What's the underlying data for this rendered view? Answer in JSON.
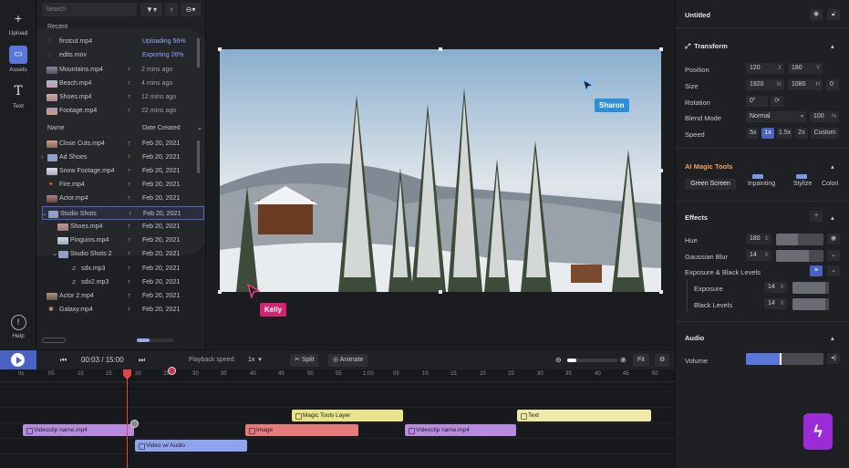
{
  "rail": {
    "upload": "Upload",
    "assets": "Assets",
    "text": "Text",
    "help": "Help"
  },
  "assets": {
    "search_placeholder": "Search",
    "recent_label": "Recent",
    "recent": [
      {
        "name": "firstcut.mp4",
        "status": "Uploading 56%"
      },
      {
        "name": "edits.mov",
        "status": "Exporting 26%"
      },
      {
        "name": "Mountains.mp4",
        "time": "2 mins ago"
      },
      {
        "name": "Beach.mp4",
        "time": "4 mins ago"
      },
      {
        "name": "Shoes.mp4",
        "time": "12 mins ago"
      },
      {
        "name": "Footage.mp4",
        "time": "22 mins ago"
      }
    ],
    "col_name": "Name",
    "col_date": "Date Created",
    "files": [
      {
        "name": "Close Cuts.mp4",
        "date": "Feb 20, 2021"
      },
      {
        "name": "Ad Shoes",
        "date": "Feb 20, 2021"
      },
      {
        "name": "Snow Footage.mp4",
        "date": "Feb 20, 2021"
      },
      {
        "name": "Fire.mp4",
        "date": "Feb 20, 2021"
      },
      {
        "name": "Actor.mp4",
        "date": "Feb 20, 2021"
      },
      {
        "name": "Studio Shots",
        "date": "Feb 20, 2021"
      },
      {
        "name": "Shoes.mp4",
        "date": "Feb 20, 2021"
      },
      {
        "name": "Pinguins.mp4",
        "date": "Feb 20, 2021"
      },
      {
        "name": "Studio Shots 2",
        "date": "Feb 20, 2021"
      },
      {
        "name": "sdx.mp3",
        "date": "Feb 20, 2021"
      },
      {
        "name": "sdx2.mp3",
        "date": "Feb 20, 2021"
      },
      {
        "name": "Actor 2.mp4",
        "date": "Feb 20, 2021"
      },
      {
        "name": "Galaxy.mp4",
        "date": "Feb 20, 2021"
      }
    ]
  },
  "stage": {
    "cursor_sharon": "Sharon",
    "cursor_kelly": "Kelly"
  },
  "transport": {
    "time": "00:03 / 15:00",
    "speed_label": "Playback speed:",
    "speed_value": "1x",
    "split": "Split",
    "animate": "Animate",
    "fit": "Fit"
  },
  "timeline": {
    "ticks": [
      "0s",
      "05",
      "10",
      "15",
      "20",
      "25",
      "30",
      "35",
      "40",
      "45",
      "50",
      "55",
      "1:00",
      "05",
      "10",
      "15",
      "20",
      "25",
      "30",
      "35",
      "40",
      "45",
      "50"
    ],
    "clips": {
      "magic": "Magic Tools Layer",
      "text": "Text",
      "video1": "Videoclip name.mp4",
      "image": "Image",
      "video2": "Videoclip name.mp4",
      "audio": "Video w/ Audio"
    }
  },
  "panel": {
    "title": "Untitled",
    "transform": {
      "heading": "Transform",
      "position": "Position",
      "pos_x": "120",
      "pos_y": "180",
      "size": "Size",
      "w": "1920",
      "h": "1080",
      "d": "0",
      "rotation": "Rotation",
      "rot": "0°",
      "blend": "Blend Mode",
      "blend_value": "Normal",
      "opacity": "100",
      "speed": "Speed",
      "speeds": [
        ".5x",
        "1x",
        "1.5x",
        "2x",
        "Custom"
      ]
    },
    "ai": {
      "heading": "AI Magic Tools",
      "tools": [
        "Green Screen",
        "Inpainting",
        "Stylize",
        "Colori"
      ]
    },
    "effects": {
      "heading": "Effects",
      "hue": "Hue",
      "hue_value": "180",
      "blur": "Gaussian Blur",
      "blur_value": "14",
      "exposure_group": "Exposure & Black Levels",
      "exposure": "Exposure",
      "exposure_value": "14",
      "black": "Black Levels",
      "black_value": "14"
    },
    "audio": {
      "heading": "Audio",
      "volume": "Volume"
    }
  },
  "colors": {
    "accent": "#4a62c4",
    "brand": "#9b2bd6",
    "sharon": "#2e8fd6",
    "kelly": "#d4246f"
  }
}
